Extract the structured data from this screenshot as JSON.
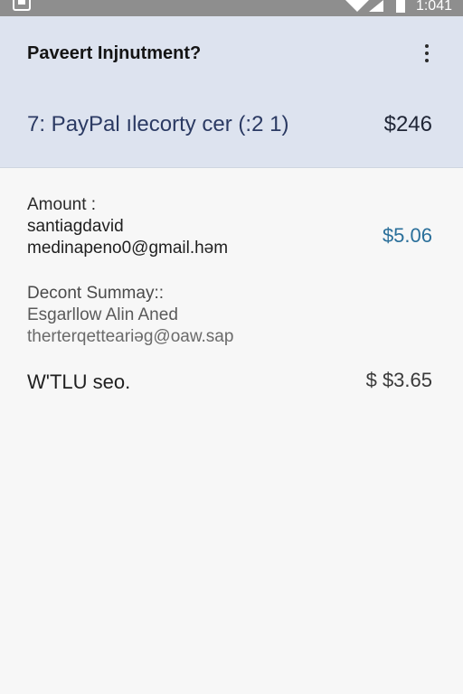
{
  "status_bar": {
    "time": "1:041",
    "icons": [
      "app-icon",
      "wifi-icon",
      "signal-icon",
      "battery-icon"
    ]
  },
  "header": {
    "title": "Paveert Injnutment?",
    "item": "7: PayPal ılecorty cer (:2 1)",
    "amount": "$246",
    "menu_icon": "more-vert-icon"
  },
  "details": {
    "amount_label": "Amount :",
    "name": "santiagdavid",
    "email": "medinapeno0@gmail.həm",
    "amount_value": "$5.06",
    "summary_label": "Decont Summay::",
    "summary_line1": "Esgarllow Alin Aned",
    "summary_line2": "therterqetteariəg@oaw.sap",
    "total_label": "W'TLU seo.",
    "total_value": "$ $3.65"
  },
  "colors": {
    "header_bg": "#dde3ef",
    "accent_blue": "#2a6f9a",
    "status_bar": "#8e8e8e"
  }
}
